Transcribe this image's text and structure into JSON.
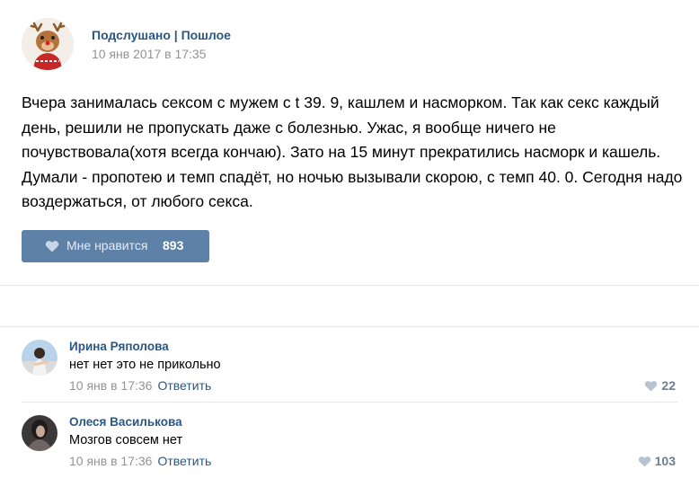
{
  "post": {
    "author": "Подслушано | Пошлое",
    "date": "10 янв 2017 в 17:35",
    "text": "Вчера занималась сексом с мужем с t 39. 9, кашлем и насморком. Так как секс каждый день, решили не пропускать даже с болезнью. Ужас, я вообще ничего не почувствовала(хотя всегда кончаю). Зато на 15 минут прекратились насморк и кашель. Думали - пропотею и темп спадёт, но ночью вызывали скорою, с темп 40. 0. Сегодня надо воздержаться, от любого секса.",
    "like_label": "Мне нравится",
    "like_count": "893",
    "like_icon": "heart-icon"
  },
  "comments": [
    {
      "name": "Ирина Ряполова",
      "text": "нет нет это не прикольно",
      "date": "10 янв в 17:36",
      "reply": "Ответить",
      "likes": "22"
    },
    {
      "name": "Олеся Василькова",
      "text": "Мозгов совсем нет",
      "date": "10 янв в 17:36",
      "reply": "Ответить",
      "likes": "103"
    }
  ],
  "colors": {
    "link": "#2a5885",
    "like_button": "#5e81a8",
    "muted": "#939393"
  }
}
